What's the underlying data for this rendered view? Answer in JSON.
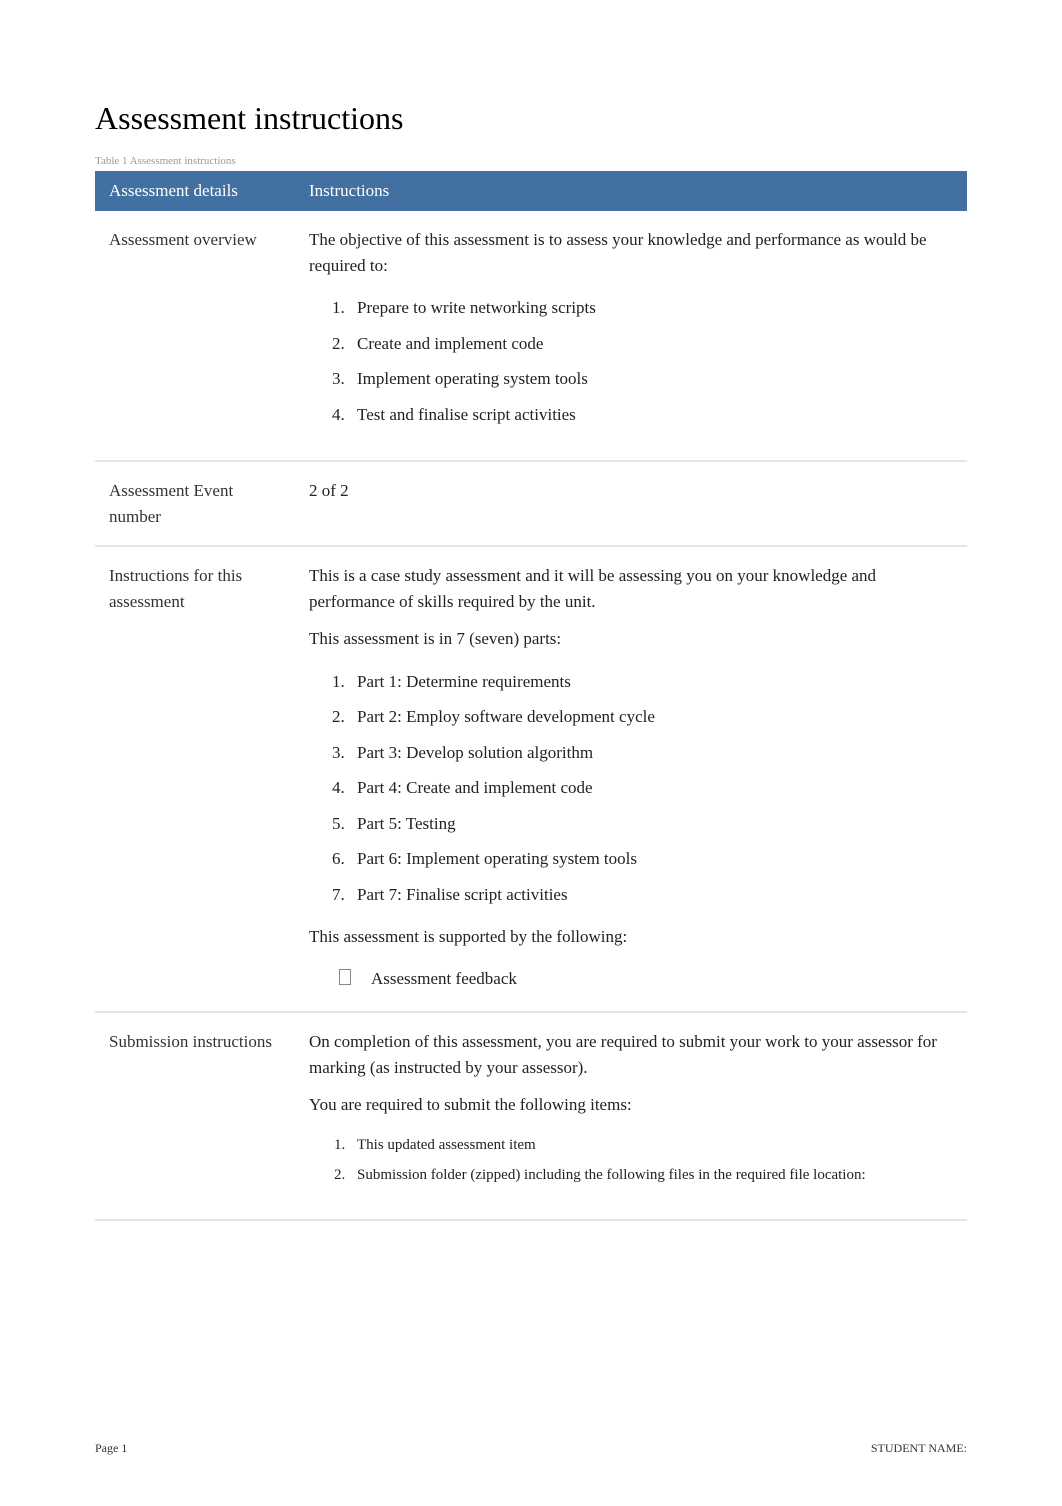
{
  "title": "Assessment instructions",
  "table_caption": "Table 1 Assessment instructions",
  "columns": {
    "col1": "Assessment details",
    "col2": "Instructions"
  },
  "rows": {
    "overview": {
      "label": "Assessment overview",
      "intro": "The objective of this assessment is to assess your knowledge and performance as would be required to:",
      "list": [
        "Prepare to write networking scripts",
        "Create and implement code",
        "Implement operating system tools",
        "Test and finalise script activities"
      ]
    },
    "event_number": {
      "label": "Assessment Event number",
      "value": "2 of 2"
    },
    "instructions": {
      "label": "Instructions for this assessment",
      "intro1": "This is a case study assessment and it will be assessing you on your knowledge and performance of skills required by the unit.",
      "intro2": "This assessment is in 7 (seven) parts:",
      "parts": [
        "Part 1: Determine requirements",
        "Part 2: Employ software development cycle",
        "Part 3: Develop solution algorithm",
        "Part 4: Create and implement code",
        "Part 5: Testing",
        "Part 6: Implement operating system tools",
        "Part 7: Finalise script activities"
      ],
      "supported": "This assessment is supported by the following:",
      "bullet": "Assessment feedback"
    },
    "submission": {
      "label": "Submission instructions",
      "intro1": "On completion of this assessment, you are required to submit your work to your assessor for marking (as instructed by your assessor).",
      "intro2": "You are required to submit the following items:",
      "items": [
        "This updated assessment item",
        "Submission folder (zipped) including the following files in the required file location:"
      ]
    }
  },
  "footer": {
    "page": "Page 1",
    "student": "STUDENT NAME:"
  }
}
